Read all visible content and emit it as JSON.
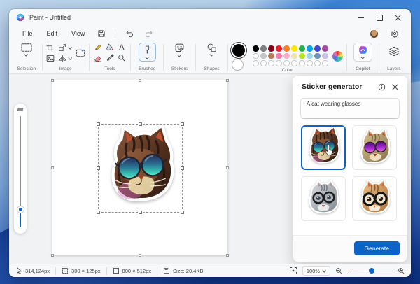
{
  "window": {
    "title": "Paint - Untitled"
  },
  "menubar": {
    "items": [
      "File",
      "Edit",
      "View"
    ]
  },
  "toolbar": {
    "selection_label": "Selection",
    "image_label": "Image",
    "tools_label": "Tools",
    "brushes_label": "Brushes",
    "stickers_label": "Stickers",
    "shapes_label": "Shapes",
    "color_label": "Color",
    "copilot_label": "Copilot",
    "layers_label": "Layers",
    "text_tool_glyph": "A",
    "palette": {
      "foreground": "#000000",
      "background": "#ffffff",
      "row1": [
        "#000000",
        "#7f7f7f",
        "#880015",
        "#ed1c24",
        "#ff7f27",
        "#ffe600",
        "#22b14c",
        "#00a2e8",
        "#3f48cc",
        "#a349a4"
      ],
      "row2": [
        "#ffffff",
        "#c3c3c3",
        "#b97a57",
        "#ff7bac",
        "#ffaec9",
        "#efe4b0",
        "#b5e61d",
        "#99d9ea",
        "#7092be",
        "#c8bfe7"
      ],
      "empty_count": 10
    }
  },
  "sticker_panel": {
    "title": "Sticker generator",
    "prompt_value": "A cat wearing glasses",
    "generate_label": "Generate",
    "thumbnails": [
      {
        "name": "tabby cat with teal sunglasses",
        "selected": true
      },
      {
        "name": "tabby cat with purple sunglasses",
        "selected": false
      },
      {
        "name": "gray cat with round glasses",
        "selected": false
      },
      {
        "name": "orange kitten with black glasses",
        "selected": false
      }
    ]
  },
  "statusbar": {
    "cursor_position": "314,124px",
    "selection_size": "300 × 125px",
    "image_size": "800 × 512px",
    "file_size": "Size: 20.4KB",
    "zoom_level": "100%"
  },
  "colors": {
    "accent": "#0c63c4",
    "workspace_bg": "#f1f2f3",
    "chrome_bg": "#f7f8fa"
  }
}
